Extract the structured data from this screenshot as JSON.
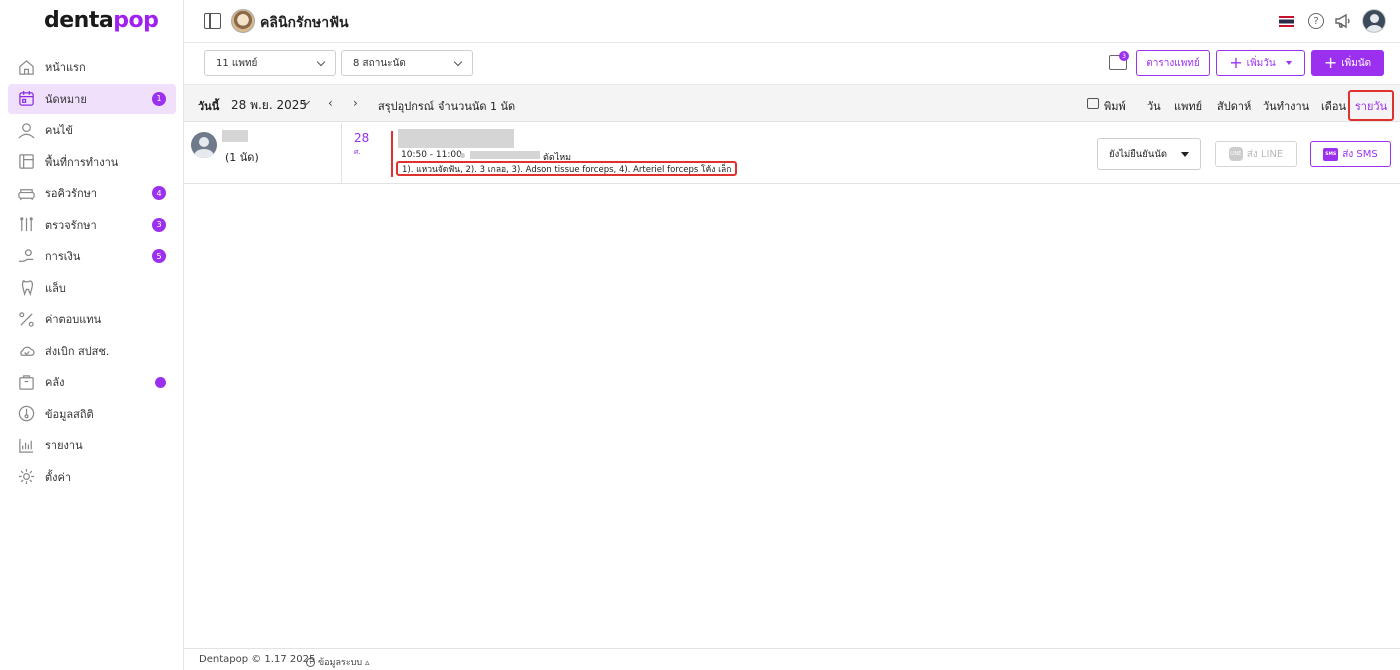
{
  "brand": {
    "logo_main": "denta",
    "logo_accent": "pop",
    "accent_color": "#9b30ee"
  },
  "sidebar": {
    "items": [
      {
        "label": "หน้าแรก",
        "icon": "home-icon",
        "active": false
      },
      {
        "label": "นัดหมาย",
        "icon": "calendar-icon",
        "active": true,
        "badge": "1"
      },
      {
        "label": "คนไข้",
        "icon": "user-icon",
        "active": false
      },
      {
        "label": "พื้นที่การทำงาน",
        "icon": "workspace-icon",
        "active": false
      },
      {
        "label": "รอคิวรักษา",
        "icon": "sofa-icon",
        "active": false,
        "badge": "4"
      },
      {
        "label": "ตรวจรักษา",
        "icon": "dental-tools-icon",
        "active": false,
        "badge": "3"
      },
      {
        "label": "การเงิน",
        "icon": "payment-icon",
        "active": false,
        "badge": "5"
      },
      {
        "label": "แล็บ",
        "icon": "tooth-icon",
        "active": false
      },
      {
        "label": "ค่าตอบแทน",
        "icon": "percent-icon",
        "active": false
      },
      {
        "label": "ส่งเบิก สปสช.",
        "icon": "cloud-icon",
        "active": false
      },
      {
        "label": "คลัง",
        "icon": "box-icon",
        "active": false,
        "dot": true
      },
      {
        "label": "ข้อมูลสถิติ",
        "icon": "thermometer-icon",
        "active": false
      },
      {
        "label": "รายงาน",
        "icon": "bar-chart-icon",
        "active": false
      },
      {
        "label": "ตั้งค่า",
        "icon": "gear-icon",
        "active": false
      }
    ]
  },
  "header": {
    "clinic_name": "คลินิกรักษาฟัน",
    "help_glyph": "?"
  },
  "filters": {
    "doctor_select": "11 แพทย์",
    "status_select": "8 สถานะนัด",
    "inbox_badge": "3"
  },
  "actions": {
    "doctor_schedule": "ตารางแพทย์",
    "add_day": "เพิ่มวัน",
    "add_appointment": "เพิ่มนัด",
    "plus_glyph": "+"
  },
  "toolbar": {
    "today": "วันนี้",
    "date": "28 พ.ย. 2025",
    "prev": "‹",
    "next": "›",
    "summary": "สรุปอุปกรณ์",
    "count": "จำนวนนัด 1 นัด",
    "print": "พิมพ์",
    "views": {
      "day": "วัน",
      "doctor": "แพทย์",
      "week": "สัปดาห์",
      "workday": "วันทำงาน",
      "month": "เดือน",
      "daily": "รายวัน"
    }
  },
  "appointment": {
    "doctor_count": "(1 นัด)",
    "date_num": "28",
    "date_dow": "ศ.",
    "time": "10:50 - 11:00",
    "type": "ตัดไหม",
    "tools": "1). แหวนจัดฟัน, 2). 3 เกลอ, 3). Adson tissue forceps, 4). Arteriel forceps โค้ง เล็ก",
    "status": "ยังไม่ยืนยันนัด",
    "send_line": "ส่ง LINE",
    "send_sms": "ส่ง SMS",
    "line_icon_text": "LINE",
    "sms_icon_text": "SMS"
  },
  "footer": {
    "copyright": "Dentapop © 1.17 2025",
    "system_info": "ข้อมูลระบบ ▵",
    "info_glyph": "i"
  }
}
